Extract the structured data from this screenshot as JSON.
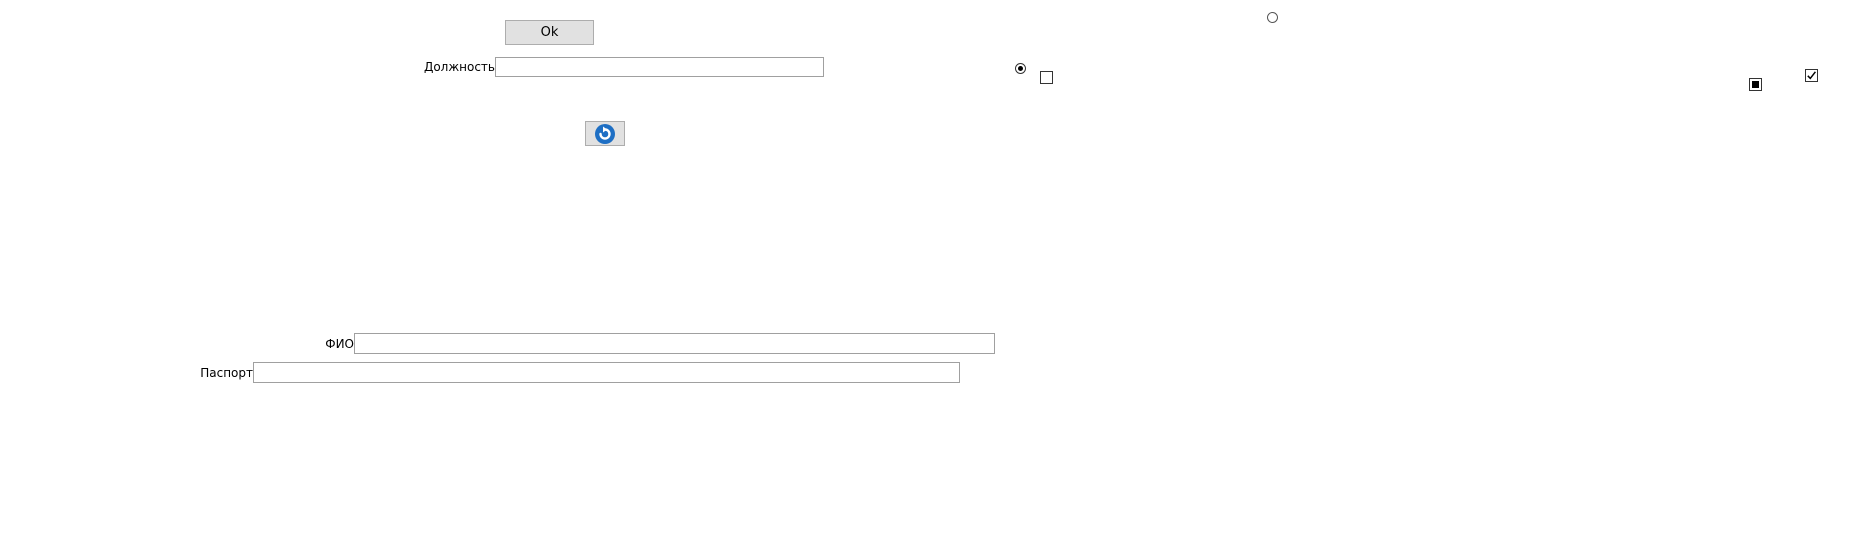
{
  "ok_button": {
    "label": "Ok"
  },
  "position_field": {
    "label": "Должность",
    "value": ""
  },
  "refresh_button": {
    "icon": "refresh-icon"
  },
  "fio_field": {
    "label": "ФИО",
    "value": ""
  },
  "passport_field": {
    "label": "Паспорт",
    "value": ""
  },
  "radio_top_right": {
    "checked": false
  },
  "radio_left": {
    "checked": true
  },
  "checkbox_left": {
    "state": "unchecked"
  },
  "checkbox_indeterminate": {
    "state": "indeterminate"
  },
  "checkbox_right": {
    "state": "checked"
  },
  "colors": {
    "button_bg": "#e1e1e1",
    "button_border": "#adadad",
    "input_border": "#a0a0a0",
    "icon_blue": "#1e6fc4"
  }
}
